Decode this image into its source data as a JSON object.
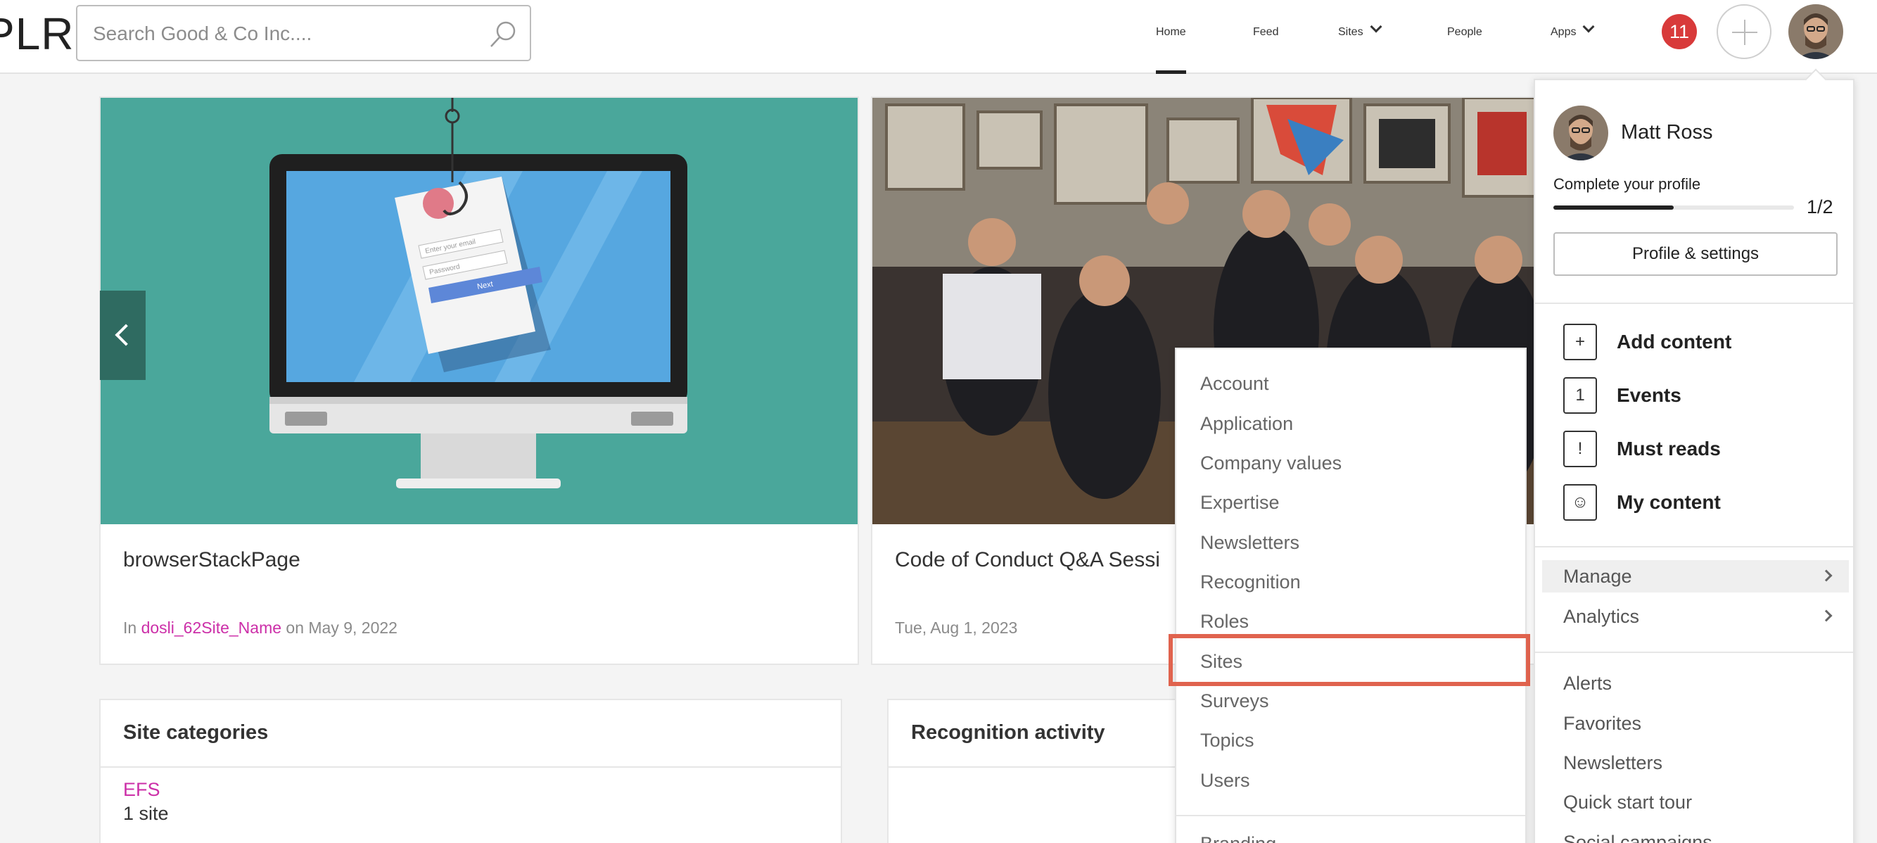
{
  "header": {
    "logo": "PLR",
    "search_placeholder": "Search Good & Co Inc....",
    "nav": {
      "home": "Home",
      "feed": "Feed",
      "sites": "Sites",
      "people": "People",
      "apps": "Apps"
    },
    "notification_count": "11"
  },
  "featured": [
    {
      "title": "browserStackPage",
      "meta_prefix": "In",
      "site_link": "dosli_62Site_Name",
      "meta_suffix": "on May 9, 2022",
      "image": {
        "login_email_placeholder": "Enter your email",
        "login_password_placeholder": "Password",
        "login_button": "Next"
      }
    },
    {
      "title": "Code of Conduct Q&A Sessi",
      "meta": "Tue, Aug 1, 2023"
    }
  ],
  "panels": {
    "site_categories": {
      "heading": "Site categories",
      "category": "EFS",
      "count": "1 site"
    },
    "recognition": {
      "heading": "Recognition activity"
    }
  },
  "manage_menu": {
    "items": [
      "Account",
      "Application",
      "Company values",
      "Expertise",
      "Newsletters",
      "Recognition",
      "Roles",
      "Sites",
      "Surveys",
      "Topics",
      "Users"
    ],
    "highlighted": "Sites",
    "partial_item": "Branding"
  },
  "user_menu": {
    "name": "Matt Ross",
    "complete_profile": "Complete your profile",
    "progress_label": "1/2",
    "progress_fraction": 0.5,
    "profile_button": "Profile & settings",
    "actions": [
      {
        "label": "Add content",
        "icon": "plus-icon"
      },
      {
        "label": "Events",
        "icon": "calendar-icon"
      },
      {
        "label": "Must reads",
        "icon": "exclamation-icon"
      },
      {
        "label": "My content",
        "icon": "person-doc-icon"
      }
    ],
    "manage": "Manage",
    "analytics": "Analytics",
    "links": [
      "Alerts",
      "Favorites",
      "Newsletters",
      "Quick start tour",
      "Social campaigns"
    ]
  },
  "colors": {
    "accent_link": "#cc2fa8",
    "badge": "#d83a3a",
    "highlight": "#e0634e",
    "carousel_bg": "#4aa79b"
  }
}
